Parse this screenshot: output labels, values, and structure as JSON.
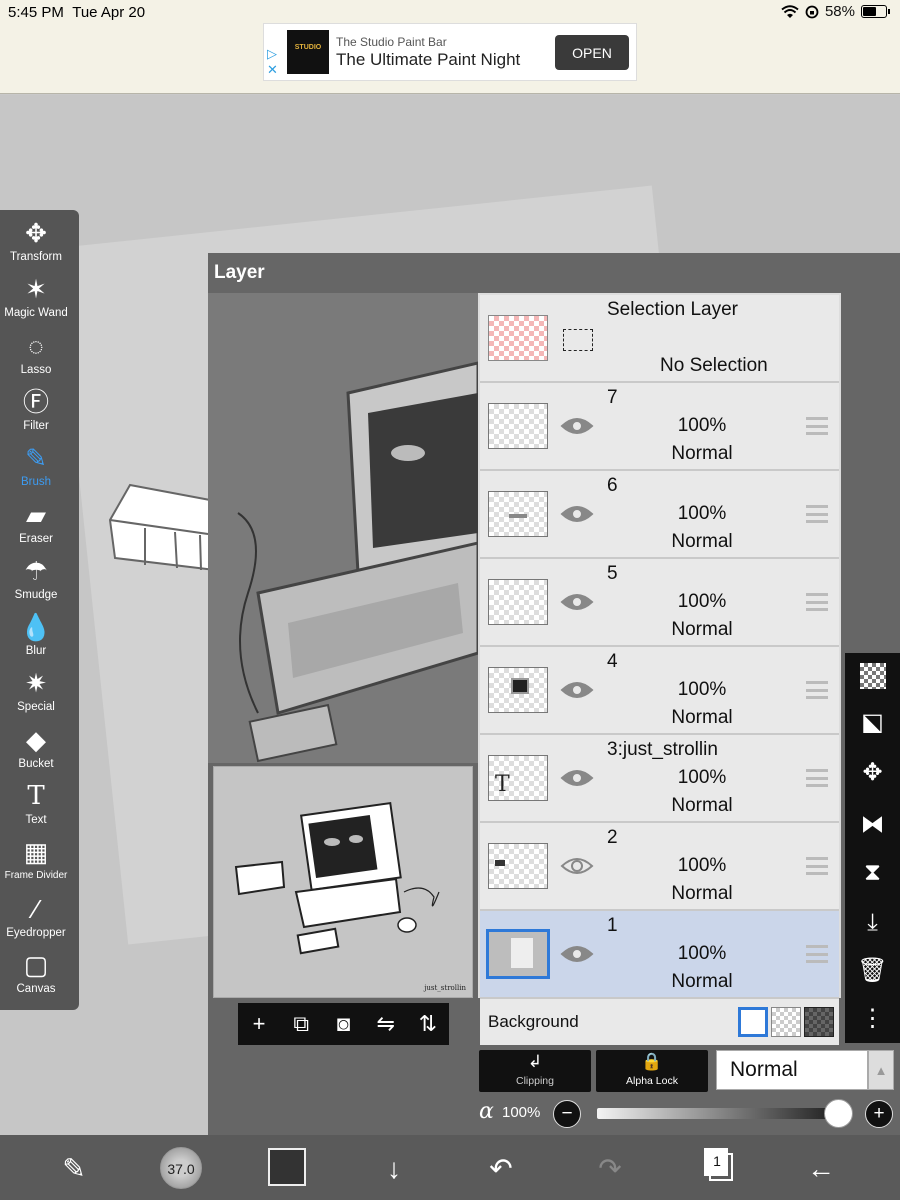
{
  "status_bar": {
    "time": "5:45 PM",
    "date": "Tue Apr 20",
    "battery": "58%"
  },
  "ad": {
    "advertiser": "The Studio Paint Bar",
    "headline": "The Ultimate Paint Night",
    "button": "OPEN",
    "logo_text": "STUDIO"
  },
  "tools": [
    {
      "label": "Transform",
      "icon": "transform-icon"
    },
    {
      "label": "Magic Wand",
      "icon": "magic-wand-icon"
    },
    {
      "label": "Lasso",
      "icon": "lasso-icon"
    },
    {
      "label": "Filter",
      "icon": "fx-icon"
    },
    {
      "label": "Brush",
      "icon": "brush-icon",
      "active": true
    },
    {
      "label": "Eraser",
      "icon": "eraser-icon"
    },
    {
      "label": "Smudge",
      "icon": "smudge-icon"
    },
    {
      "label": "Blur",
      "icon": "blur-drop-icon"
    },
    {
      "label": "Special",
      "icon": "special-icon"
    },
    {
      "label": "Bucket",
      "icon": "bucket-icon"
    },
    {
      "label": "Text",
      "icon": "text-icon"
    },
    {
      "label": "Frame Divider",
      "icon": "frame-divider-icon"
    },
    {
      "label": "Eyedropper",
      "icon": "eyedropper-icon"
    },
    {
      "label": "Canvas",
      "icon": "canvas-icon"
    }
  ],
  "panel": {
    "title": "Layer"
  },
  "thumbnail": {
    "signature": "just_strollin"
  },
  "selection_layer": {
    "title": "Selection Layer",
    "status": "No Selection"
  },
  "layers": [
    {
      "name": "7",
      "opacity": "100%",
      "mode": "Normal",
      "visible": true
    },
    {
      "name": "6",
      "opacity": "100%",
      "mode": "Normal",
      "visible": true
    },
    {
      "name": "5",
      "opacity": "100%",
      "mode": "Normal",
      "visible": true
    },
    {
      "name": "4",
      "opacity": "100%",
      "mode": "Normal",
      "visible": true
    },
    {
      "name": "3:just_strollin",
      "opacity": "100%",
      "mode": "Normal",
      "visible": true
    },
    {
      "name": "2",
      "opacity": "100%",
      "mode": "Normal",
      "visible": false
    },
    {
      "name": "1",
      "opacity": "100%",
      "mode": "Normal",
      "visible": true,
      "selected": true
    }
  ],
  "background": {
    "label": "Background"
  },
  "controls": {
    "clipping": "Clipping",
    "alpha_lock": "Alpha Lock",
    "blend_mode": "Normal",
    "alpha_symbol": "α",
    "alpha_value": "100%",
    "alpha_fraction": 1.0
  },
  "bottom_bar": {
    "brush_size": "37.0",
    "pages": "1",
    "brush_color": "#333333"
  },
  "colors": {
    "accent": "#3d9bf0",
    "selected_row": "#cbd6ea",
    "selected_thumb_border": "#2e79d8"
  }
}
